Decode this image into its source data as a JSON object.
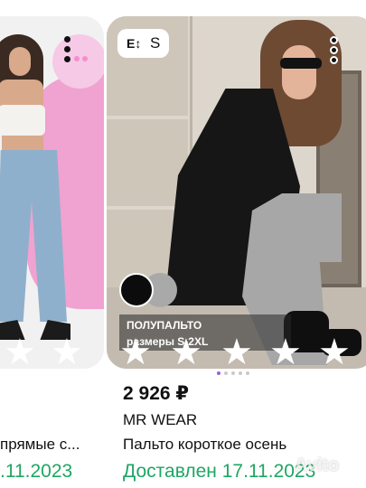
{
  "left_card": {
    "title_partial": "прямые с...",
    "date_partial": ".11.2023",
    "menu_icon": "more-vertical-icon",
    "star_icons": [
      "star-icon",
      "star-icon"
    ]
  },
  "right_card": {
    "size_badge": {
      "icon": "size-icon",
      "icon_glyph": "E↕",
      "label": "S"
    },
    "menu_icon": "more-vertical-icon",
    "color_swatches": [
      {
        "name": "black",
        "color": "#0c0c0c"
      },
      {
        "name": "gray",
        "color": "#a9a9a9"
      }
    ],
    "photo_overlay_text_line1": "ПОЛУПАЛЬТО",
    "photo_overlay_text_line2": "размеры S-2XL",
    "price": "2 926 ₽",
    "brand": "MR WEAR",
    "title": "Пальто короткое осень",
    "delivered": "Доставлен 17.11.2023",
    "star_icons": [
      "star-icon",
      "star-icon",
      "star-icon",
      "star-icon",
      "star-icon"
    ],
    "carousel_dots": 5,
    "carousel_active_index": 0
  },
  "watermark": "Avito",
  "colors": {
    "delivered_green": "#1ea763",
    "active_dot": "#9b5fd4",
    "pink_background": "#f0a2d0"
  }
}
